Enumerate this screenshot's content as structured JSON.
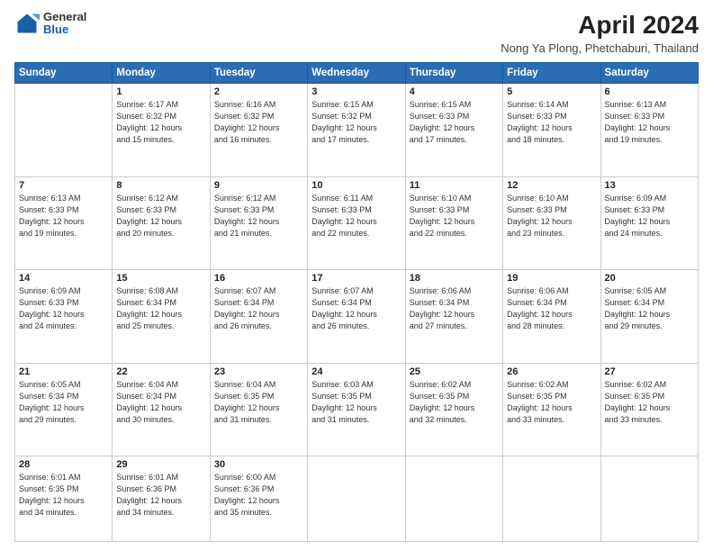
{
  "header": {
    "logo_general": "General",
    "logo_blue": "Blue",
    "main_title": "April 2024",
    "subtitle": "Nong Ya Plong, Phetchaburi, Thailand"
  },
  "weekdays": [
    "Sunday",
    "Monday",
    "Tuesday",
    "Wednesday",
    "Thursday",
    "Friday",
    "Saturday"
  ],
  "weeks": [
    [
      {
        "day": "",
        "info": ""
      },
      {
        "day": "1",
        "info": "Sunrise: 6:17 AM\nSunset: 6:32 PM\nDaylight: 12 hours\nand 15 minutes."
      },
      {
        "day": "2",
        "info": "Sunrise: 6:16 AM\nSunset: 6:32 PM\nDaylight: 12 hours\nand 16 minutes."
      },
      {
        "day": "3",
        "info": "Sunrise: 6:15 AM\nSunset: 6:32 PM\nDaylight: 12 hours\nand 17 minutes."
      },
      {
        "day": "4",
        "info": "Sunrise: 6:15 AM\nSunset: 6:33 PM\nDaylight: 12 hours\nand 17 minutes."
      },
      {
        "day": "5",
        "info": "Sunrise: 6:14 AM\nSunset: 6:33 PM\nDaylight: 12 hours\nand 18 minutes."
      },
      {
        "day": "6",
        "info": "Sunrise: 6:13 AM\nSunset: 6:33 PM\nDaylight: 12 hours\nand 19 minutes."
      }
    ],
    [
      {
        "day": "7",
        "info": "Sunrise: 6:13 AM\nSunset: 6:33 PM\nDaylight: 12 hours\nand 19 minutes."
      },
      {
        "day": "8",
        "info": "Sunrise: 6:12 AM\nSunset: 6:33 PM\nDaylight: 12 hours\nand 20 minutes."
      },
      {
        "day": "9",
        "info": "Sunrise: 6:12 AM\nSunset: 6:33 PM\nDaylight: 12 hours\nand 21 minutes."
      },
      {
        "day": "10",
        "info": "Sunrise: 6:11 AM\nSunset: 6:33 PM\nDaylight: 12 hours\nand 22 minutes."
      },
      {
        "day": "11",
        "info": "Sunrise: 6:10 AM\nSunset: 6:33 PM\nDaylight: 12 hours\nand 22 minutes."
      },
      {
        "day": "12",
        "info": "Sunrise: 6:10 AM\nSunset: 6:33 PM\nDaylight: 12 hours\nand 23 minutes."
      },
      {
        "day": "13",
        "info": "Sunrise: 6:09 AM\nSunset: 6:33 PM\nDaylight: 12 hours\nand 24 minutes."
      }
    ],
    [
      {
        "day": "14",
        "info": "Sunrise: 6:09 AM\nSunset: 6:33 PM\nDaylight: 12 hours\nand 24 minutes."
      },
      {
        "day": "15",
        "info": "Sunrise: 6:08 AM\nSunset: 6:34 PM\nDaylight: 12 hours\nand 25 minutes."
      },
      {
        "day": "16",
        "info": "Sunrise: 6:07 AM\nSunset: 6:34 PM\nDaylight: 12 hours\nand 26 minutes."
      },
      {
        "day": "17",
        "info": "Sunrise: 6:07 AM\nSunset: 6:34 PM\nDaylight: 12 hours\nand 26 minutes."
      },
      {
        "day": "18",
        "info": "Sunrise: 6:06 AM\nSunset: 6:34 PM\nDaylight: 12 hours\nand 27 minutes."
      },
      {
        "day": "19",
        "info": "Sunrise: 6:06 AM\nSunset: 6:34 PM\nDaylight: 12 hours\nand 28 minutes."
      },
      {
        "day": "20",
        "info": "Sunrise: 6:05 AM\nSunset: 6:34 PM\nDaylight: 12 hours\nand 29 minutes."
      }
    ],
    [
      {
        "day": "21",
        "info": "Sunrise: 6:05 AM\nSunset: 6:34 PM\nDaylight: 12 hours\nand 29 minutes."
      },
      {
        "day": "22",
        "info": "Sunrise: 6:04 AM\nSunset: 6:34 PM\nDaylight: 12 hours\nand 30 minutes."
      },
      {
        "day": "23",
        "info": "Sunrise: 6:04 AM\nSunset: 6:35 PM\nDaylight: 12 hours\nand 31 minutes."
      },
      {
        "day": "24",
        "info": "Sunrise: 6:03 AM\nSunset: 6:35 PM\nDaylight: 12 hours\nand 31 minutes."
      },
      {
        "day": "25",
        "info": "Sunrise: 6:02 AM\nSunset: 6:35 PM\nDaylight: 12 hours\nand 32 minutes."
      },
      {
        "day": "26",
        "info": "Sunrise: 6:02 AM\nSunset: 6:35 PM\nDaylight: 12 hours\nand 33 minutes."
      },
      {
        "day": "27",
        "info": "Sunrise: 6:02 AM\nSunset: 6:35 PM\nDaylight: 12 hours\nand 33 minutes."
      }
    ],
    [
      {
        "day": "28",
        "info": "Sunrise: 6:01 AM\nSunset: 6:35 PM\nDaylight: 12 hours\nand 34 minutes."
      },
      {
        "day": "29",
        "info": "Sunrise: 6:01 AM\nSunset: 6:36 PM\nDaylight: 12 hours\nand 34 minutes."
      },
      {
        "day": "30",
        "info": "Sunrise: 6:00 AM\nSunset: 6:36 PM\nDaylight: 12 hours\nand 35 minutes."
      },
      {
        "day": "",
        "info": ""
      },
      {
        "day": "",
        "info": ""
      },
      {
        "day": "",
        "info": ""
      },
      {
        "day": "",
        "info": ""
      }
    ]
  ]
}
